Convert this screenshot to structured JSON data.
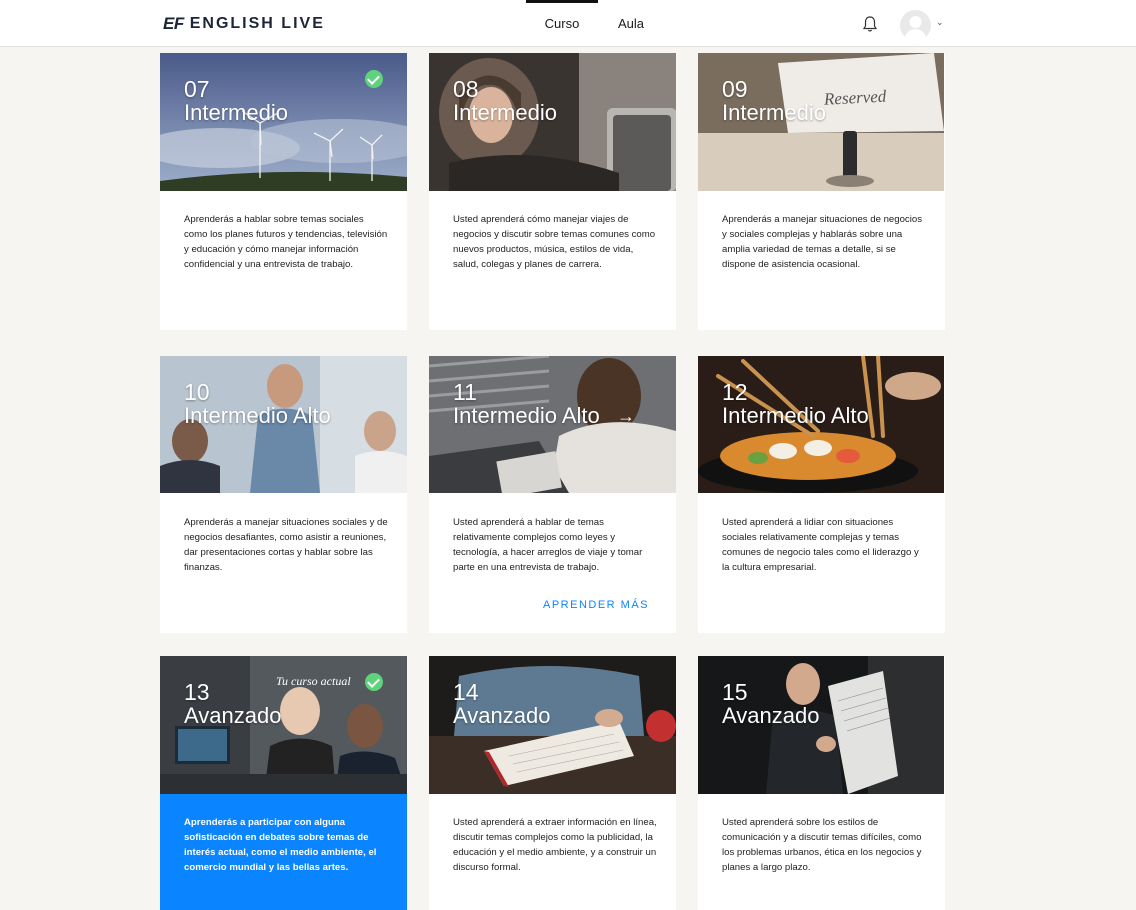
{
  "header": {
    "logo_mark": "EF",
    "logo_text": "ENGLISH LIVE",
    "tabs": [
      {
        "label": "Curso",
        "active": true
      },
      {
        "label": "Aula",
        "active": false
      }
    ],
    "icons": {
      "notifications": "bell-icon",
      "avatar": "user-avatar",
      "menu": "chevron-down-icon"
    }
  },
  "colors": {
    "accent": "#0a84ff",
    "complete": "#5fd27c",
    "background": "#f7f5f2"
  },
  "cards": [
    {
      "number": "07",
      "level": "Intermedio",
      "completed": true,
      "desc": "Aprenderás a hablar sobre temas sociales como los planes futuros y tendencias, televisión y educación y cómo manejar información confidencial y una entrevista de trabajo."
    },
    {
      "number": "08",
      "level": "Intermedio",
      "desc": "Usted aprenderá cómo manejar viajes de negocios y discutir sobre temas comunes como nuevos productos, música, estilos de vida, salud, colegas y planes de carrera."
    },
    {
      "number": "09",
      "level": "Intermedio",
      "image_text": "Reserved",
      "desc": "Aprenderás a manejar situaciones de negocios y sociales complejas y hablarás sobre una amplia variedad de temas a detalle, si se dispone de asistencia ocasional."
    },
    {
      "number": "10",
      "level": "Intermedio Alto",
      "desc": "Aprenderás a manejar situaciones sociales y de negocios desafiantes, como asistir a reuniones, dar presentaciones cortas y hablar sobre las finanzas."
    },
    {
      "number": "11",
      "level": "Intermedio Alto",
      "arrow": "→",
      "learn_more": "APRENDER MÁS",
      "desc": "Usted aprenderá a hablar de temas relativamente complejos como leyes y tecnología, a hacer arreglos de viaje y tomar parte en una entrevista de trabajo."
    },
    {
      "number": "12",
      "level": "Intermedio Alto",
      "desc": "Usted aprenderá a lidiar con situaciones sociales relativamente complejas y temas comunes de negocio tales como el liderazgo y la cultura empresarial."
    },
    {
      "number": "13",
      "level": "Avanzado",
      "completed": true,
      "current_label": "Tu curso actual",
      "desc": "Aprenderás a participar con alguna sofisticación en debates sobre temas de interés actual, como el medio ambiente, el comercio mundial y las bellas artes."
    },
    {
      "number": "14",
      "level": "Avanzado",
      "desc": "Usted aprenderá a extraer información en línea, discutir temas complejos como la publicidad, la educación y el medio ambiente, y a construir un discurso formal."
    },
    {
      "number": "15",
      "level": "Avanzado",
      "desc": "Usted aprenderá sobre los estilos de comunicación y a discutir temas difíciles, como los problemas urbanos, ética en los negocios y planes a largo plazo."
    }
  ]
}
